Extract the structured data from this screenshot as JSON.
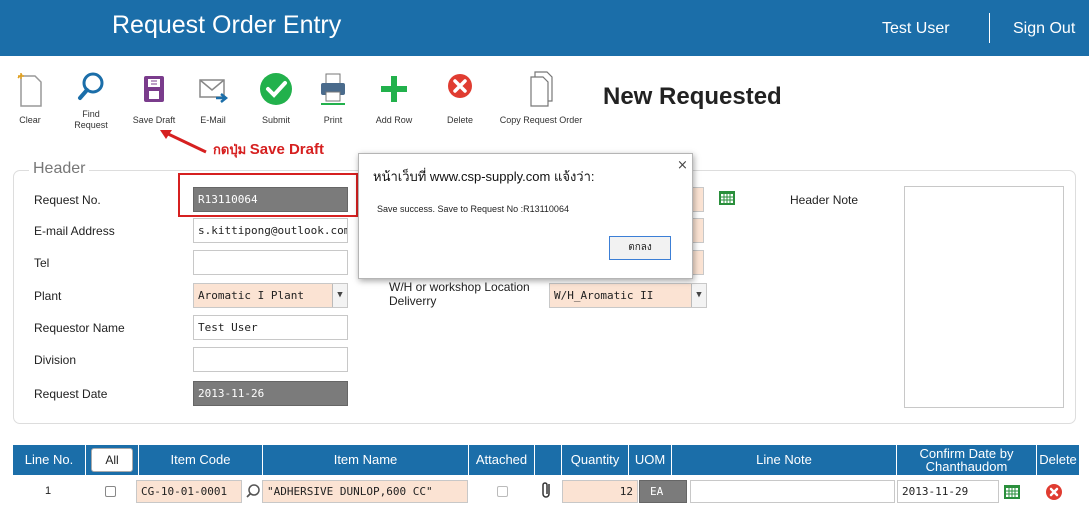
{
  "app": {
    "title": "Request Order Entry",
    "user": "Test User",
    "signout": "Sign Out"
  },
  "toolbar": {
    "clear": "Clear",
    "find": "Find Request",
    "save_draft": "Save Draft",
    "email": "E-Mail",
    "submit": "Submit",
    "print": "Print",
    "add_row": "Add Row",
    "delete": "Delete",
    "copy": "Copy Request Order"
  },
  "status_text": "New Requested",
  "annotation": {
    "prefix": "กดปุ่ม",
    "bold": "Save Draft"
  },
  "header": {
    "legend": "Header",
    "request_no_label": "Request No.",
    "request_no": "R13110064",
    "email_label": "E-mail Address",
    "email": "s.kittipong@outlook.com",
    "tel_label": "Tel",
    "tel": "",
    "plant_label": "Plant",
    "plant": "Aromatic I Plant",
    "requestor_label": "Requestor Name",
    "requestor": "Test User",
    "division_label": "Division",
    "division": "",
    "request_date_label": "Request Date",
    "request_date": "2013-11-26",
    "wh_label": "W/H or workshop Location Deliverry",
    "wh": "W/H_Aromatic II",
    "header_note_label": "Header Note",
    "header_note": ""
  },
  "dialog": {
    "title": "หน้าเว็บที่ www.csp-supply.com แจ้งว่า:",
    "message": "Save success.  Save to Request No :R13110064",
    "ok": "ตกลง",
    "close": "×"
  },
  "table": {
    "headers": {
      "line_no": "Line No.",
      "all": "All",
      "item_code": "Item Code",
      "item_name": "Item Name",
      "attached": "Attached",
      "quantity": "Quantity",
      "uom": "UOM",
      "line_note": "Line Note",
      "confirm_date": "Confirm Date by Chanthaudom",
      "delete": "Delete"
    },
    "rows": [
      {
        "line_no": "1",
        "item_code": "CG-10-01-0001",
        "item_name": "\"ADHERSIVE DUNLOP,600 CC\"",
        "quantity": "12",
        "uom": "EA",
        "line_note": "",
        "confirm_date": "2013-11-29"
      }
    ]
  },
  "colors": {
    "brand": "#1b6ea9",
    "save_purple": "#7a3c8c",
    "submit_green": "#22b14c",
    "delete_red": "#e03c31",
    "annotation_red": "#d62020"
  }
}
